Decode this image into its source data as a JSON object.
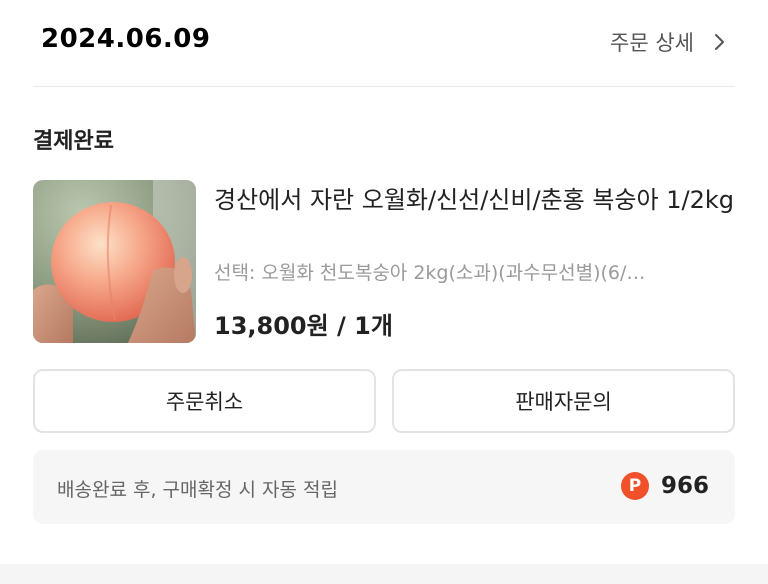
{
  "order": {
    "date": "2024.06.09",
    "detail_label": "주문 상세",
    "status": "결제완료"
  },
  "product": {
    "title": "경산에서 자란 오월화/신선/신비/춘홍 복숭아 1/2kg",
    "option": "선택: 오월화 천도복숭아 2kg(소과)(과수무선별)(6/…",
    "price": "13,800원 / 1개",
    "image_icon": "peach-product-photo"
  },
  "actions": {
    "cancel_label": "주문취소",
    "inquiry_label": "판매자문의"
  },
  "points": {
    "text": "배송완료 후, 구매확정 시 자동 적립",
    "badge": "P",
    "value": "966"
  },
  "colors": {
    "point_badge": "#f0502a",
    "option_text": "#9a9a9a",
    "box_background": "#f6f6f6"
  }
}
